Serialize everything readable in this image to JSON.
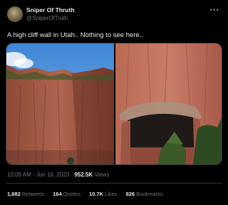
{
  "author": {
    "name": "Sniper Of Thruth",
    "handle": "@SniperOfTruth"
  },
  "tweet": {
    "text": "A high cliff wall in Utah.. Nothing to see here.."
  },
  "meta": {
    "time": "10:09 AM",
    "separator": "·",
    "date": "Jun 16, 2023",
    "views_count": "952.5K",
    "views_label": "Views"
  },
  "stats": {
    "retweets_count": "1,682",
    "retweets_label": "Retweets",
    "quotes_count": "164",
    "quotes_label": "Quotes",
    "likes_count": "10.7K",
    "likes_label": "Likes",
    "bookmarks_count": "826",
    "bookmarks_label": "Bookmarks"
  },
  "icons": {
    "more": "more-icon"
  }
}
